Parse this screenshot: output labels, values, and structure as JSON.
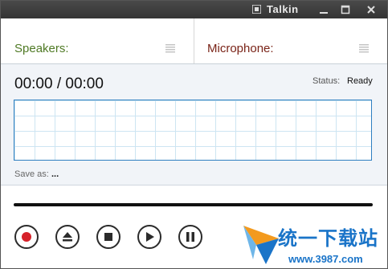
{
  "window": {
    "title": "Talkin"
  },
  "tabs": {
    "speakers": "Speakers:",
    "microphone": "Microphone:"
  },
  "recorder": {
    "time": "00:00 / 00:00",
    "status_label": "Status:",
    "status_value": "Ready",
    "save_as_label": "Save as:",
    "save_as_value": "..."
  },
  "controls": {
    "record_color": "#d6222a",
    "icons": [
      "record-icon",
      "eject-icon",
      "stop-icon",
      "play-icon",
      "pause-icon"
    ]
  },
  "watermark": {
    "text": "统一下载站",
    "url": "www.3987.com"
  }
}
